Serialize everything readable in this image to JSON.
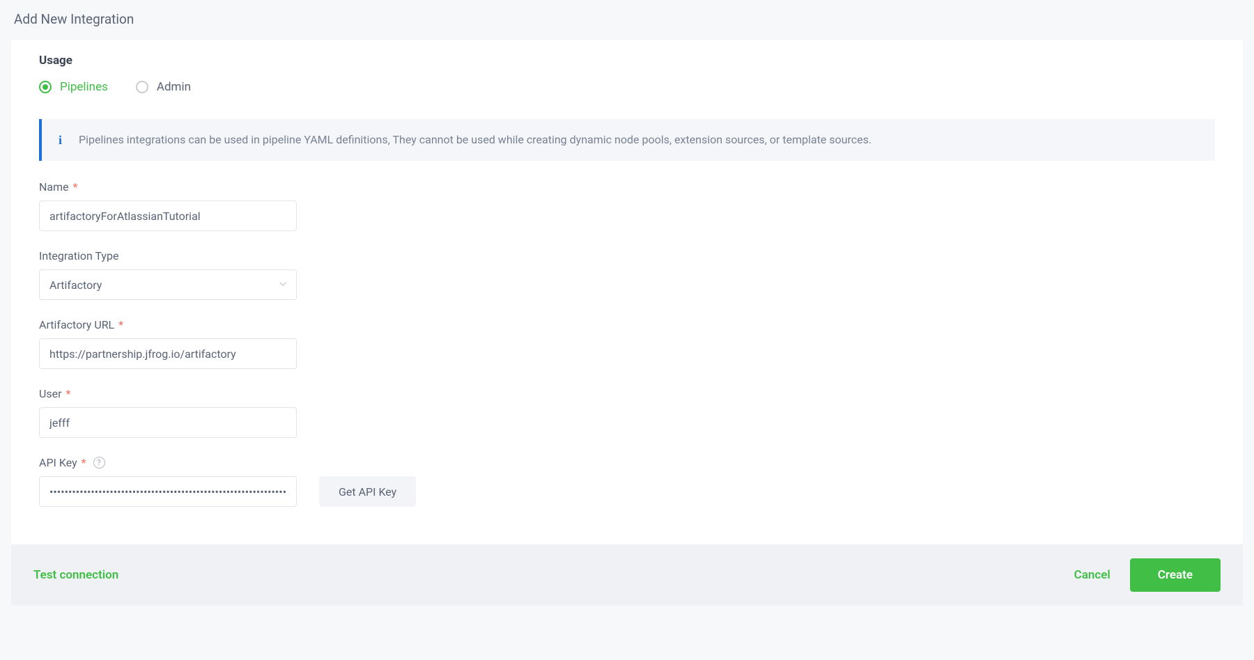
{
  "header": {
    "title": "Add New Integration"
  },
  "usage": {
    "label": "Usage",
    "options": {
      "pipelines": "Pipelines",
      "admin": "Admin"
    },
    "selected": "pipelines"
  },
  "info": {
    "text": "Pipelines integrations can be used in pipeline YAML definitions, They cannot be used while creating dynamic node pools, extension sources, or template sources."
  },
  "form": {
    "name": {
      "label": "Name",
      "value": "artifactoryForAtlassianTutorial"
    },
    "integration_type": {
      "label": "Integration Type",
      "value": "Artifactory"
    },
    "artifactory_url": {
      "label": "Artifactory URL",
      "value": "https://partnership.jfrog.io/artifactory"
    },
    "user": {
      "label": "User",
      "value": "jefff"
    },
    "api_key": {
      "label": "API Key",
      "value": "••••••••••••••••••••••••••••••••••••••••••••••••••••••••••••••••••••",
      "get_button": "Get API Key"
    }
  },
  "footer": {
    "test_connection": "Test connection",
    "cancel": "Cancel",
    "create": "Create"
  }
}
